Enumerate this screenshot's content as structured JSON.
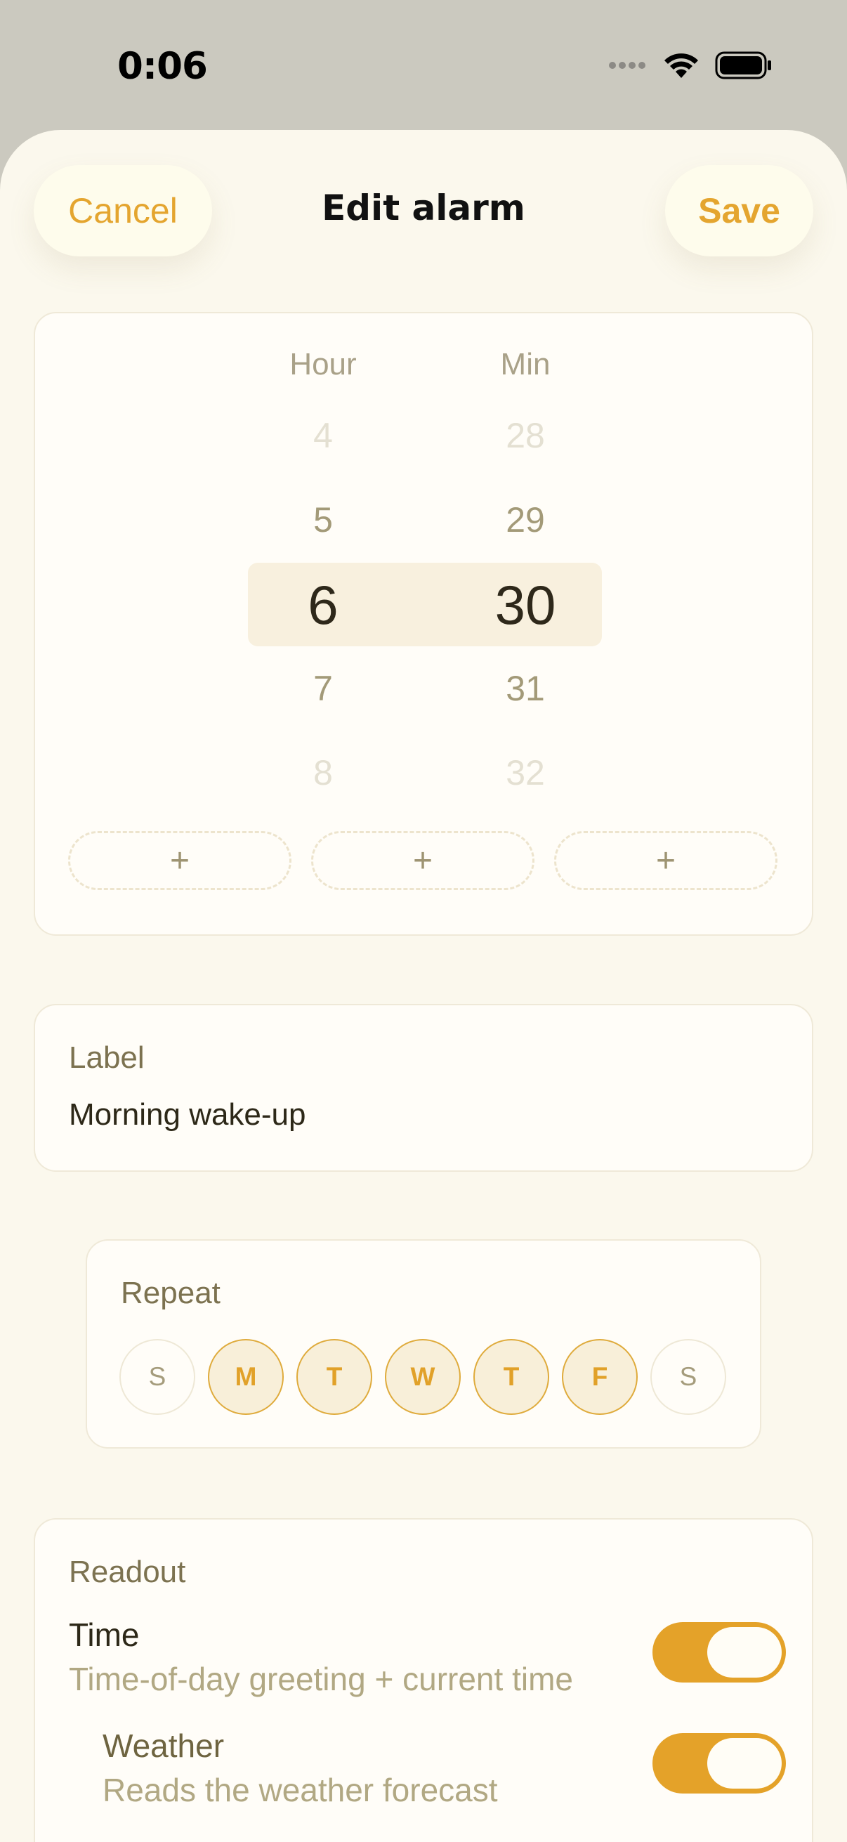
{
  "status_bar": {
    "time": "0:06",
    "icons": [
      "signal-dots-icon",
      "wifi-icon",
      "battery-icon"
    ]
  },
  "nav": {
    "cancel_label": "Cancel",
    "title": "Edit alarm",
    "save_label": "Save"
  },
  "picker": {
    "hour_header": "Hour",
    "min_header": "Min",
    "hours": [
      "4",
      "5",
      "6",
      "7",
      "8"
    ],
    "minutes": [
      "28",
      "29",
      "30",
      "31",
      "32"
    ],
    "selected_hour": "6",
    "selected_minute": "30",
    "add_buttons": [
      "+",
      "+",
      "+"
    ]
  },
  "label": {
    "title": "Label",
    "value": "Morning wake-up"
  },
  "repeat": {
    "title": "Repeat",
    "days": [
      {
        "letter": "S",
        "selected": false
      },
      {
        "letter": "M",
        "selected": true
      },
      {
        "letter": "T",
        "selected": true
      },
      {
        "letter": "W",
        "selected": true
      },
      {
        "letter": "T",
        "selected": true
      },
      {
        "letter": "F",
        "selected": true
      },
      {
        "letter": "S",
        "selected": false
      }
    ]
  },
  "readout": {
    "title": "Readout",
    "items": [
      {
        "title": "Time",
        "subtitle": "Time-of-day greeting + current time",
        "enabled": true
      },
      {
        "title": "Weather",
        "subtitle": "Reads the weather forecast",
        "enabled": true
      }
    ]
  },
  "colors": {
    "accent": "#e4a229",
    "sheet": "#fbf8ed",
    "card": "#fffdf8",
    "backdrop": "#cbc9bf"
  }
}
